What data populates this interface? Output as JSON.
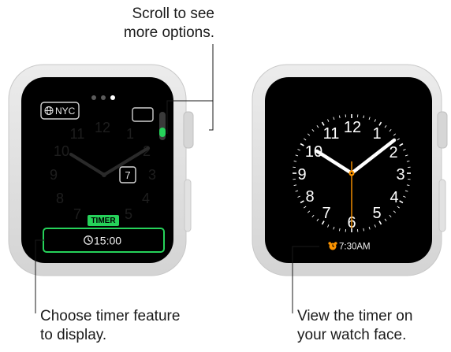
{
  "callouts": {
    "scroll": [
      "Scroll to see",
      "more options."
    ],
    "timer_feature": [
      "Choose timer feature",
      "to display."
    ],
    "view_timer": [
      "View the timer on",
      "your watch face."
    ]
  },
  "left_watch": {
    "complication_city": "NYC",
    "date_box": "7",
    "timer_tag": "TIMER",
    "timer_value": "15:00",
    "page_dots": 3,
    "active_dot": 2,
    "dial_numbers": [
      "12",
      "1",
      "2",
      "3",
      "4",
      "5",
      "6",
      "7",
      "8",
      "9",
      "10",
      "11"
    ],
    "globe_icon": "globe-icon",
    "timer_icon": "timer-icon"
  },
  "right_watch": {
    "dial_numbers": [
      "12",
      "1",
      "2",
      "3",
      "4",
      "5",
      "6",
      "7",
      "8",
      "9",
      "10",
      "11"
    ],
    "alarm_time": "7:30AM",
    "alarm_icon": "alarm-clock-icon"
  },
  "colors": {
    "accent_green": "#26d25a",
    "hand_orange": "#ff9500",
    "bezel": "#dcdcdc",
    "screen": "#000000",
    "caption": "#1a1a1a"
  }
}
